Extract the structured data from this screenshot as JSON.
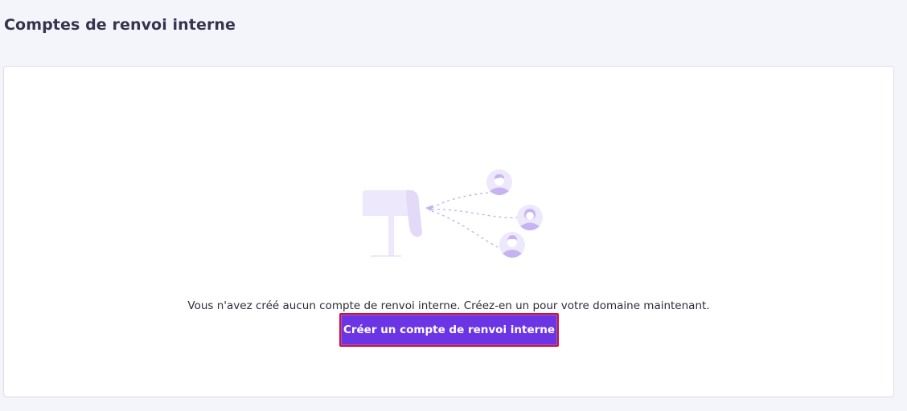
{
  "page": {
    "title": "Comptes de renvoi interne"
  },
  "empty_state": {
    "illustration": "mailbox-forwarding-to-users-icon",
    "message": "Vous n'avez créé aucun compte de renvoi interne. Créez-en un pour votre domaine maintenant.",
    "button_label": "Créer un compte de renvoi interne"
  },
  "colors": {
    "accent": "#6b35e6",
    "highlight_border": "#d6112c",
    "illustration_light": "#ede8fb",
    "illustration_mid": "#c5b4f1"
  }
}
